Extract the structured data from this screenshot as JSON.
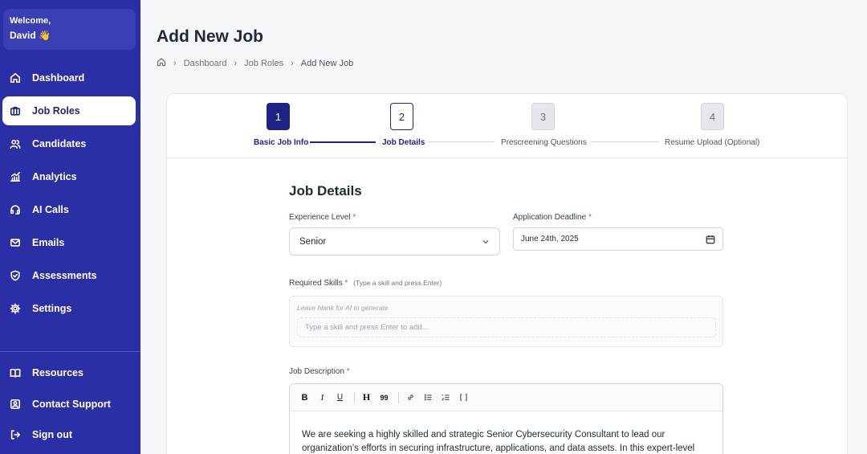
{
  "sidebar": {
    "welcome_label": "Welcome,",
    "user_name": "David 👋",
    "items": [
      {
        "label": "Dashboard",
        "icon": "home-icon"
      },
      {
        "label": "Job Roles",
        "icon": "briefcase-icon",
        "active": true
      },
      {
        "label": "Candidates",
        "icon": "users-icon"
      },
      {
        "label": "Analytics",
        "icon": "chart-icon"
      },
      {
        "label": "AI Calls",
        "icon": "headset-icon"
      },
      {
        "label": "Emails",
        "icon": "mail-icon"
      },
      {
        "label": "Assessments",
        "icon": "shield-check-icon"
      },
      {
        "label": "Settings",
        "icon": "gear-icon"
      }
    ],
    "bottom_items": [
      {
        "label": "Resources",
        "icon": "book-icon"
      },
      {
        "label": "Contact Support",
        "icon": "contact-icon"
      },
      {
        "label": "Sign out",
        "icon": "sign-out-icon"
      }
    ],
    "colors": {
      "background": "#2a2fa6",
      "active_bg": "#ffffff",
      "active_text": "#1e2486"
    }
  },
  "header": {
    "title": "Add New Job",
    "breadcrumb": [
      "Dashboard",
      "Job Roles",
      "Add New Job"
    ]
  },
  "stepper": {
    "steps": [
      {
        "number": "1",
        "label": "Basic Job Info",
        "state": "done"
      },
      {
        "number": "2",
        "label": "Job Details",
        "state": "current"
      },
      {
        "number": "3",
        "label": "Prescreening Questions",
        "state": "todo"
      },
      {
        "number": "4",
        "label": "Resume Upload (Optional)",
        "state": "todo"
      }
    ]
  },
  "form": {
    "section_title": "Job Details",
    "experience": {
      "label": "Experience Level",
      "required": "*",
      "value": "Senior"
    },
    "deadline": {
      "label": "Application Deadline",
      "required": "*",
      "value": "June 24th, 2025"
    },
    "skills": {
      "label": "Required Skills",
      "required": "*",
      "hint": "(Type a skill and press Enter)",
      "blank_note": "Leave blank for AI to generate",
      "placeholder": "Type a skill and press Enter to add..."
    },
    "description": {
      "label": "Job Description",
      "required": "*",
      "toolbar": [
        "B",
        "I",
        "U",
        "H",
        "99"
      ],
      "text": "We are seeking a highly skilled and strategic Senior Cybersecurity Consultant to lead our organization’s efforts in securing infrastructure, applications, and data assets. In this expert-level role,"
    }
  }
}
